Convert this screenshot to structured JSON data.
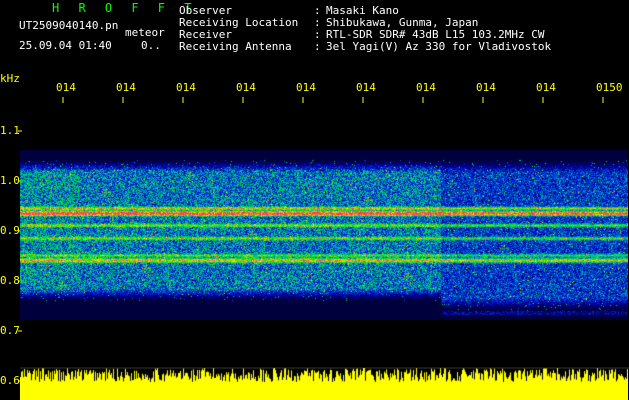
{
  "header": {
    "app_title": "H R O F F T",
    "filename": "UT2509040140.pn",
    "meteor": "meteor",
    "date": "25.09.04 01:40",
    "count": "0..",
    "labels": [
      "Observer",
      "Receiving Location",
      "Receiver",
      "Receiving Antenna"
    ],
    "values": [
      "Masaki Kano",
      "Shibukawa, Gunma, Japan",
      "RTL-SDR SDR# 43dB L15 103.2MHz CW",
      "3el Yagi(V) Az 330 for Vladivostok"
    ],
    "colon": ":"
  },
  "axes": {
    "y_unit": "kHz",
    "y_ticks": [
      "1.1",
      "1.0",
      "0.9",
      "0.8",
      "0.7",
      "0.6"
    ],
    "x_ticks": [
      "014",
      "014",
      "014",
      "014",
      "014",
      "014",
      "014",
      "014",
      "014",
      "0150"
    ]
  },
  "colors": {
    "background": "#000000",
    "axis": "#ffff00",
    "title": "#00ff00",
    "text": "#ffffff"
  }
}
